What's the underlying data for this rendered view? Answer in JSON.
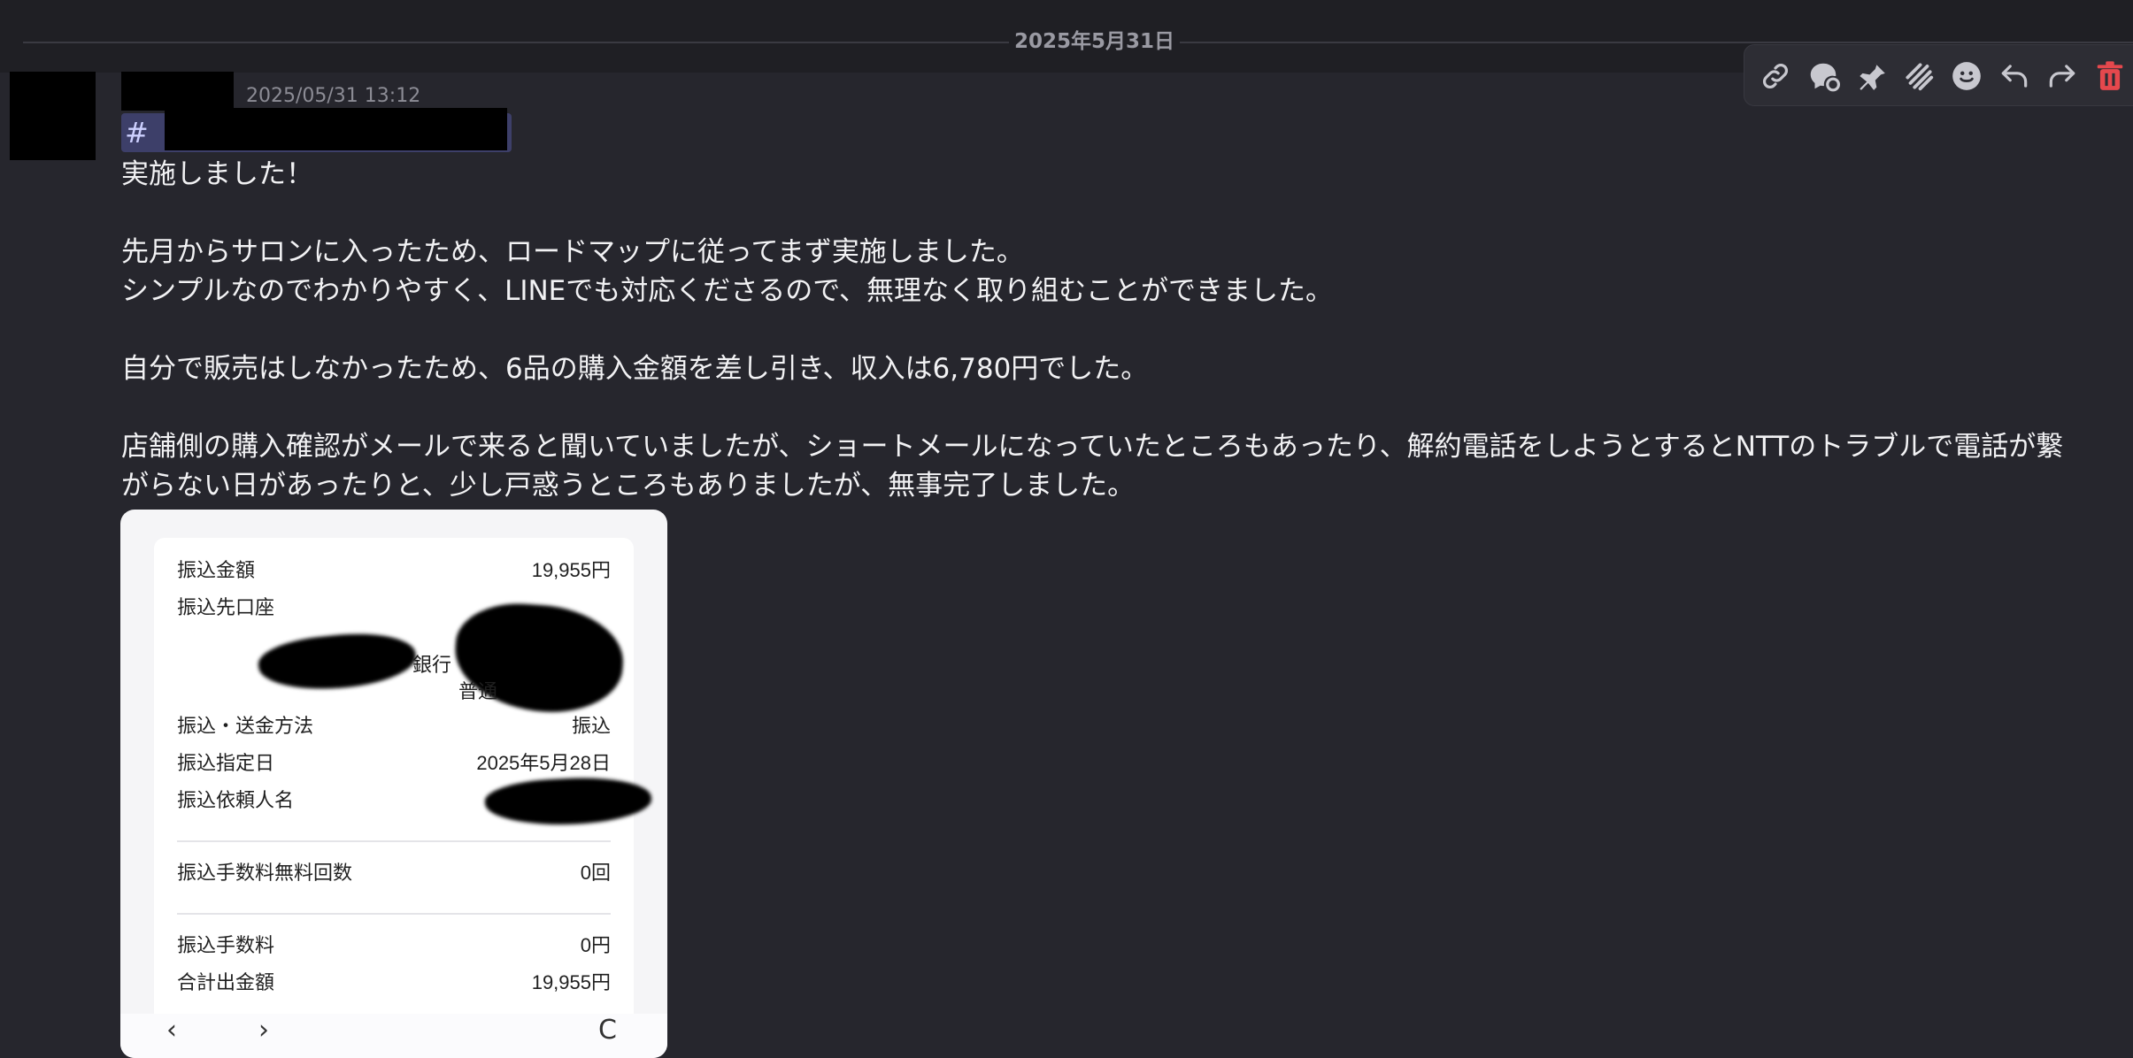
{
  "date_divider": "2025年5月31日",
  "message": {
    "timestamp": "2025/05/31 13:12",
    "channel_hash": "#",
    "lines": [
      "実施しました！",
      "",
      "先月からサロンに入ったため、ロードマップに従ってまず実施しました。",
      "シンプルなのでわかりやすく、LINEでも対応くださるので、無理なく取り組むことができました。",
      "",
      "自分で販売はしなかったため、6品の購入金額を差し引き、収入は6,780円でした。",
      "",
      "店舗側の購入確認がメールで来ると聞いていましたが、ショートメールになっていたところもあったり、解約電話をしようとするとNTTのトラブルで電話が繋",
      "がらない日があったりと、少し戸惑うところもありましたが、無事完了しました。"
    ]
  },
  "toolbar": {
    "icons": [
      "link-icon",
      "thread-reply-icon",
      "pin-icon",
      "stack-icon",
      "emoji-icon",
      "reply-icon",
      "forward-icon",
      "delete-icon"
    ],
    "delete_color": "#e5484d"
  },
  "attachment": {
    "amount_label": "振込金額",
    "amount_value": "19,955円",
    "account_label": "振込先口座",
    "bank_suffix": "銀行",
    "account_type": "普通",
    "method_label": "振込・送金方法",
    "method_value": "振込",
    "date_label": "振込指定日",
    "date_value": "2025年5月28日",
    "requester_label": "振込依頼人名",
    "free_count_label": "振込手数料無料回数",
    "free_count_value": "0回",
    "fee_label": "振込手数料",
    "fee_value": "0円",
    "total_label": "合計出金額",
    "total_value": "19,955円",
    "nav_back": "‹",
    "nav_forward": "›",
    "nav_reload": "C"
  }
}
